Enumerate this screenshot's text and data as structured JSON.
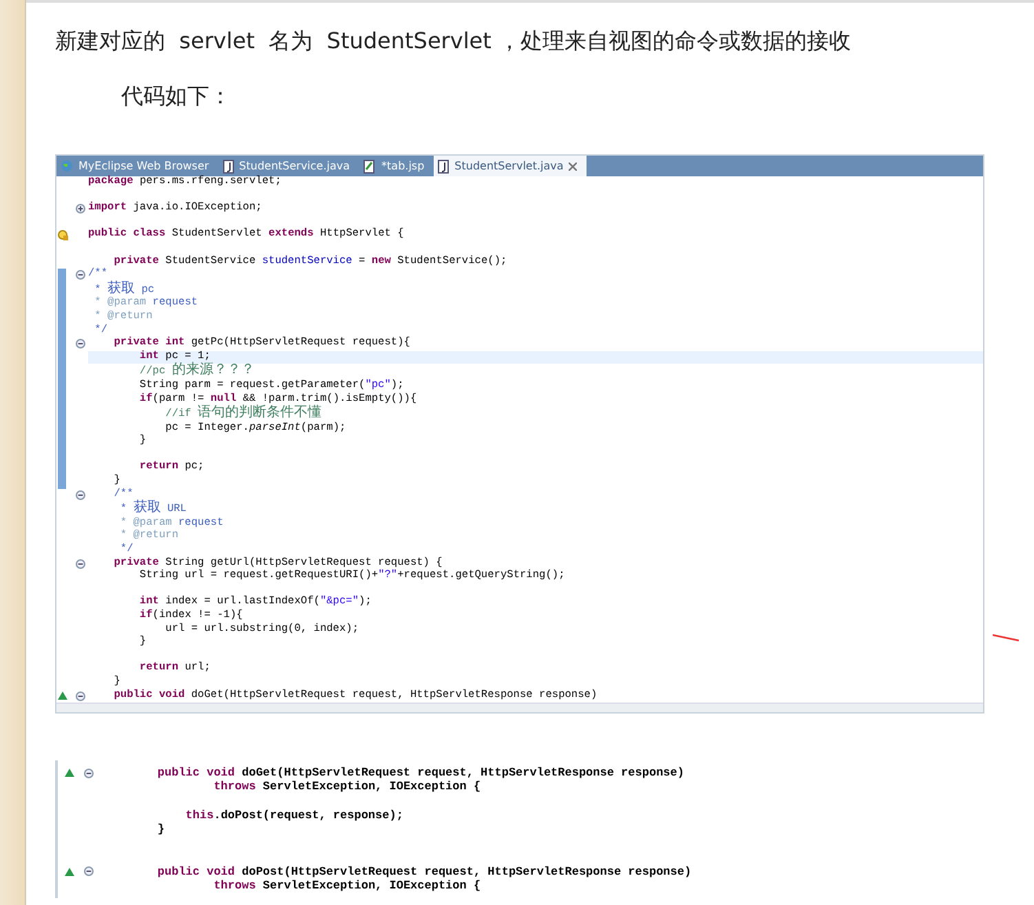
{
  "intro": {
    "text": "新建对应的  servlet  名为  StudentServlet ，处理来自视图的命令或数据的接收",
    "subtext": "代码如下："
  },
  "editor": {
    "tabs": [
      {
        "label": "MyEclipse Web Browser",
        "kind": "browser",
        "selected": false
      },
      {
        "label": "StudentService.java",
        "kind": "java",
        "selected": false
      },
      {
        "label": "*tab.jsp",
        "kind": "jsp",
        "selected": false
      },
      {
        "label": "StudentServlet.java",
        "kind": "java",
        "selected": true
      }
    ],
    "lines": [
      {
        "kind": "code",
        "segments": [
          {
            "kind": "kw",
            "text": "package"
          },
          {
            "kind": "plain",
            "text": " pers.ms.rfeng.servlet;"
          }
        ]
      },
      {
        "kind": "blank"
      },
      {
        "kind": "code",
        "segments": [
          {
            "kind": "kw",
            "text": "import"
          },
          {
            "kind": "plain",
            "text": " java.io.IOException;"
          }
        ],
        "folded": true
      },
      {
        "kind": "blank"
      },
      {
        "kind": "code",
        "segments": [
          {
            "kind": "kw",
            "text": "public class"
          },
          {
            "kind": "plain",
            "text": " StudentServlet "
          },
          {
            "kind": "kw",
            "text": "extends"
          },
          {
            "kind": "plain",
            "text": " HttpServlet {"
          }
        ],
        "warning": true
      },
      {
        "kind": "blank"
      },
      {
        "kind": "code",
        "segments": [
          {
            "kind": "kw",
            "text": "    private"
          },
          {
            "kind": "plain",
            "text": " StudentService "
          },
          {
            "kind": "field",
            "text": "studentService"
          },
          {
            "kind": "plain",
            "text": " = "
          },
          {
            "kind": "kw",
            "text": "new"
          },
          {
            "kind": "plain",
            "text": " StudentService();"
          }
        ]
      },
      {
        "kind": "code",
        "segments": [
          {
            "kind": "doc",
            "text": "/**"
          }
        ],
        "folded": false,
        "changed": true
      },
      {
        "kind": "code",
        "segments": [
          {
            "kind": "doc",
            "text": " * 获取 pc"
          }
        ],
        "changed": true
      },
      {
        "kind": "code",
        "segments": [
          {
            "kind": "doctag",
            "text": " * @param"
          },
          {
            "kind": "doc",
            "text": " request"
          }
        ],
        "changed": true
      },
      {
        "kind": "code",
        "segments": [
          {
            "kind": "doctag",
            "text": " * @return"
          }
        ],
        "changed": true
      },
      {
        "kind": "code",
        "segments": [
          {
            "kind": "doc",
            "text": " */"
          }
        ],
        "changed": true
      },
      {
        "kind": "code",
        "segments": [
          {
            "kind": "kw",
            "text": "    private int"
          },
          {
            "kind": "plain",
            "text": " getPc(HttpServletRequest request){"
          }
        ],
        "folded": false,
        "changed": true
      },
      {
        "kind": "code",
        "segments": [
          {
            "kind": "kw",
            "text": "        int"
          },
          {
            "kind": "plain",
            "text": " pc = 1;"
          }
        ],
        "changed": true,
        "highlighted": true
      },
      {
        "kind": "code",
        "segments": [
          {
            "kind": "comment",
            "text": "        //pc 的来源？？？"
          }
        ],
        "changed": true
      },
      {
        "kind": "code",
        "segments": [
          {
            "kind": "plain",
            "text": "        String parm = request.getParameter("
          },
          {
            "kind": "str",
            "text": "\"pc\""
          },
          {
            "kind": "plain",
            "text": ");"
          }
        ],
        "changed": true
      },
      {
        "kind": "code",
        "segments": [
          {
            "kind": "kw",
            "text": "        if"
          },
          {
            "kind": "plain",
            "text": "(parm != "
          },
          {
            "kind": "kw",
            "text": "null"
          },
          {
            "kind": "plain",
            "text": " && !parm.trim().isEmpty()){"
          }
        ],
        "changed": true
      },
      {
        "kind": "code",
        "segments": [
          {
            "kind": "comment",
            "text": "            //if 语句的判断条件不懂"
          }
        ],
        "changed": true
      },
      {
        "kind": "code",
        "segments": [
          {
            "kind": "plain",
            "text": "            pc = Integer."
          },
          {
            "kind": "italic",
            "text": "parseInt"
          },
          {
            "kind": "plain",
            "text": "(parm);"
          }
        ],
        "changed": true
      },
      {
        "kind": "code",
        "segments": [
          {
            "kind": "plain",
            "text": "        }"
          }
        ],
        "changed": true
      },
      {
        "kind": "blank",
        "changed": true
      },
      {
        "kind": "code",
        "segments": [
          {
            "kind": "kw",
            "text": "        return"
          },
          {
            "kind": "plain",
            "text": " pc;"
          }
        ],
        "changed": true
      },
      {
        "kind": "code",
        "segments": [
          {
            "kind": "plain",
            "text": "    }"
          }
        ],
        "changed": true
      },
      {
        "kind": "code",
        "segments": [
          {
            "kind": "doc",
            "text": "    /**"
          }
        ],
        "folded": false
      },
      {
        "kind": "code",
        "segments": [
          {
            "kind": "doc",
            "text": "     * 获取 URL"
          }
        ]
      },
      {
        "kind": "code",
        "segments": [
          {
            "kind": "doctag",
            "text": "     * @param"
          },
          {
            "kind": "doc",
            "text": " request"
          }
        ]
      },
      {
        "kind": "code",
        "segments": [
          {
            "kind": "doctag",
            "text": "     * @return"
          }
        ]
      },
      {
        "kind": "code",
        "segments": [
          {
            "kind": "doc",
            "text": "     */"
          }
        ]
      },
      {
        "kind": "code",
        "segments": [
          {
            "kind": "kw",
            "text": "    private"
          },
          {
            "kind": "plain",
            "text": " String getUrl(HttpServletRequest request) {"
          }
        ],
        "folded": false
      },
      {
        "kind": "code",
        "segments": [
          {
            "kind": "plain",
            "text": "        String url = request.getRequestURI()+"
          },
          {
            "kind": "str",
            "text": "\"?\""
          },
          {
            "kind": "plain",
            "text": "+request.getQueryString();"
          }
        ]
      },
      {
        "kind": "blank"
      },
      {
        "kind": "code",
        "segments": [
          {
            "kind": "kw",
            "text": "        int"
          },
          {
            "kind": "plain",
            "text": " index = url.lastIndexOf("
          },
          {
            "kind": "str",
            "text": "\"&pc=\""
          },
          {
            "kind": "plain",
            "text": ");"
          }
        ]
      },
      {
        "kind": "code",
        "segments": [
          {
            "kind": "kw",
            "text": "        if"
          },
          {
            "kind": "plain",
            "text": "(index != -1){"
          }
        ]
      },
      {
        "kind": "code",
        "segments": [
          {
            "kind": "plain",
            "text": "            url = url.substring(0, index);"
          }
        ]
      },
      {
        "kind": "code",
        "segments": [
          {
            "kind": "plain",
            "text": "        }"
          }
        ]
      },
      {
        "kind": "blank"
      },
      {
        "kind": "code",
        "segments": [
          {
            "kind": "kw",
            "text": "        return"
          },
          {
            "kind": "plain",
            "text": " url;"
          }
        ]
      },
      {
        "kind": "code",
        "segments": [
          {
            "kind": "plain",
            "text": "    }"
          }
        ]
      },
      {
        "kind": "code",
        "segments": [
          {
            "kind": "kw",
            "text": "    public void"
          },
          {
            "kind": "plain",
            "text": " doGet(HttpServletRequest request, HttpServletResponse response)"
          }
        ],
        "override": true,
        "folded": false
      }
    ]
  },
  "snippet": {
    "lines": [
      {
        "kind": "code",
        "segments": [
          {
            "kind": "kw",
            "text": "    public void"
          },
          {
            "kind": "plain",
            "text": " doGet(HttpServletRequest request, HttpServletResponse response)"
          }
        ],
        "override": true,
        "folded": false
      },
      {
        "kind": "code",
        "segments": [
          {
            "kind": "kw",
            "text": "            throws"
          },
          {
            "kind": "plain",
            "text": " ServletException, IOException {"
          }
        ]
      },
      {
        "kind": "blank"
      },
      {
        "kind": "code",
        "segments": [
          {
            "kind": "kw",
            "text": "        this"
          },
          {
            "kind": "plain",
            "text": ".doPost(request, response);"
          }
        ]
      },
      {
        "kind": "code",
        "segments": [
          {
            "kind": "plain",
            "text": "    }"
          }
        ]
      },
      {
        "kind": "blank"
      },
      {
        "kind": "blank"
      },
      {
        "kind": "code",
        "segments": [
          {
            "kind": "kw",
            "text": "    public void"
          },
          {
            "kind": "plain",
            "text": " doPost(HttpServletRequest request, HttpServletResponse response)"
          }
        ],
        "override": true,
        "folded": false
      },
      {
        "kind": "code",
        "segments": [
          {
            "kind": "kw",
            "text": "            throws"
          },
          {
            "kind": "plain",
            "text": " ServletException, IOException {"
          }
        ]
      }
    ]
  }
}
